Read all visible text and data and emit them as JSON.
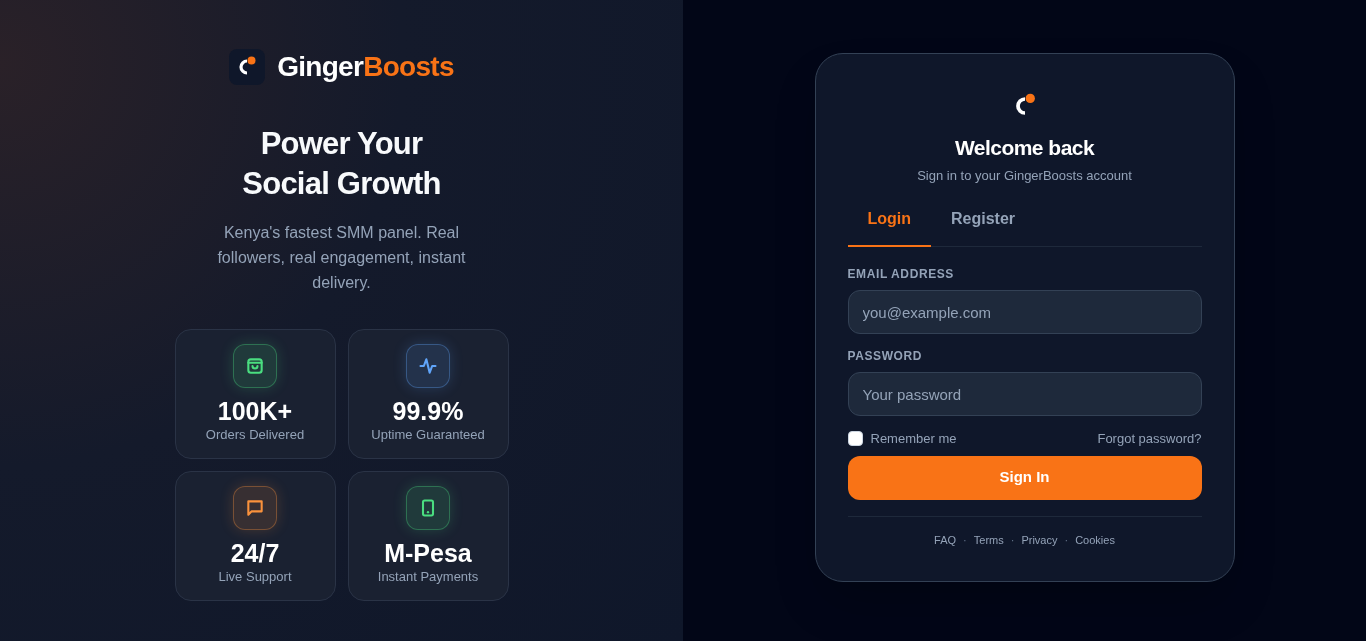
{
  "brand": {
    "name_part_1": "Ginger",
    "name_part_2": "Boosts"
  },
  "hero": {
    "title_line_1": "Power Your",
    "title_line_2": "Social Growth",
    "subtitle": "Kenya's fastest SMM panel. Real followers, real engagement, instant delivery."
  },
  "stats": [
    {
      "kind": "bag",
      "color": "#4ade80",
      "value": "100K+",
      "label": "Orders Delivered"
    },
    {
      "kind": "pulse",
      "color": "#60a5fa",
      "value": "99.9%",
      "label": "Uptime Guaranteed"
    },
    {
      "kind": "chat",
      "color": "#fb923c",
      "value": "24/7",
      "label": "Live Support"
    },
    {
      "kind": "phone",
      "color": "#4ade80",
      "value": "M-Pesa",
      "label": "Instant Payments"
    }
  ],
  "card": {
    "title": "Welcome back",
    "subtitle": "Sign in to your GingerBoosts account",
    "tabs": [
      {
        "label": "Login",
        "selected": true
      },
      {
        "label": "Register",
        "selected": false
      }
    ],
    "email": {
      "label": "EMAIL ADDRESS",
      "placeholder": "you@example.com"
    },
    "password": {
      "label": "PASSWORD",
      "placeholder": "Your password"
    },
    "remember": {
      "label": "Remember me",
      "checked": false
    },
    "forgot": "Forgot password?",
    "submit": "Sign In",
    "footer": [
      {
        "kind": "link",
        "text": "FAQ"
      },
      {
        "kind": "separator",
        "text": "·"
      },
      {
        "kind": "link",
        "text": "Terms"
      },
      {
        "kind": "separator",
        "text": "·"
      },
      {
        "kind": "link",
        "text": "Privacy"
      },
      {
        "kind": "separator",
        "text": "·"
      },
      {
        "kind": "link",
        "text": "Cookies"
      }
    ]
  }
}
